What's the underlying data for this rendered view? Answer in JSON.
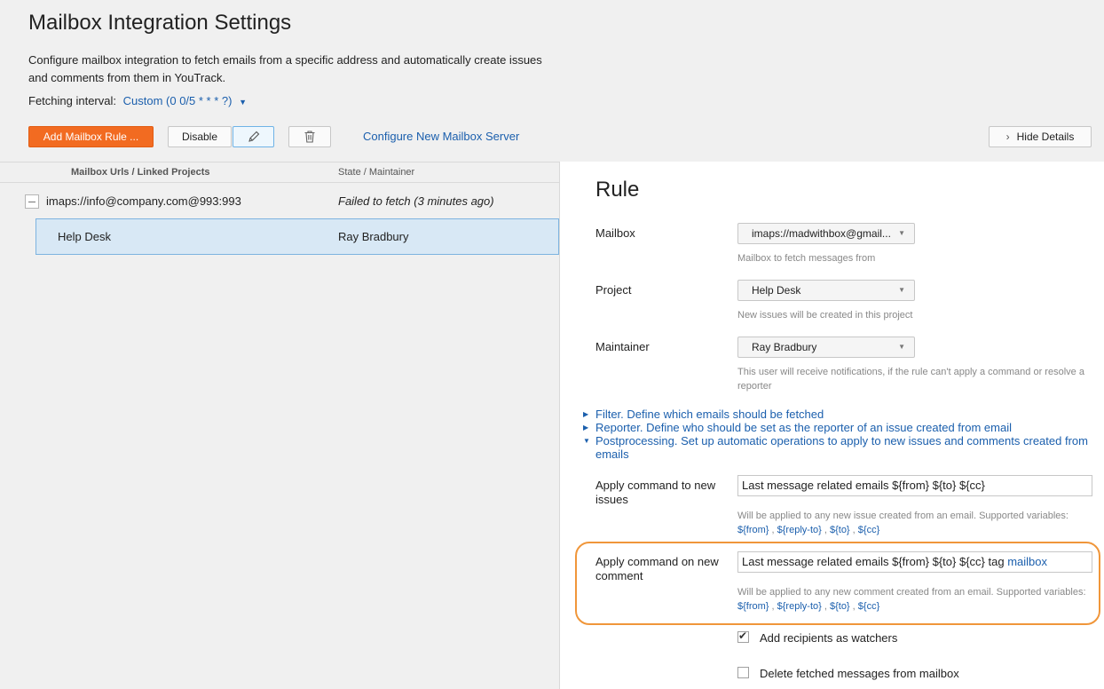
{
  "header": {
    "title": "Mailbox Integration Settings",
    "description": "Configure mailbox integration to fetch emails from a specific address and automatically create issues and comments from them in YouTrack.",
    "fetch_label": "Fetching interval:",
    "fetch_value": "Custom (0 0/5 * * * ?)"
  },
  "toolbar": {
    "add_label": "Add Mailbox Rule ...",
    "disable_label": "Disable",
    "configure_label": "Configure New Mailbox Server",
    "hide_details_label": "Hide Details"
  },
  "table": {
    "col_mailbox": "Mailbox Urls / Linked Projects",
    "col_state": "State / Maintainer",
    "mailbox_url": "imaps://info@company.com@993:993",
    "mailbox_state": "Failed to fetch (3 minutes ago)",
    "project": "Help Desk",
    "maintainer": "Ray Bradbury"
  },
  "rule": {
    "title": "Rule",
    "mailbox_label": "Mailbox",
    "mailbox_value": "imaps://madwithbox@gmail...",
    "mailbox_hint": "Mailbox to fetch messages from",
    "project_label": "Project",
    "project_value": "Help Desk",
    "project_hint": "New issues will be created in this project",
    "maintainer_label": "Maintainer",
    "maintainer_value": "Ray Bradbury",
    "maintainer_hint": "This user will receive notifications, if the rule can't apply a command or resolve a reporter",
    "sections": {
      "filter": "Filter. Define which emails should be fetched",
      "reporter": "Reporter. Define who should be set as the reporter of an issue created from email",
      "postprocessing": "Postprocessing. Set up automatic operations to apply to new issues and comments created from emails"
    },
    "cmd_issues_label": "Apply command to new issues",
    "cmd_issues_value": "Last message related emails ${from} ${to} ${cc}",
    "cmd_issues_hint": "Will be applied to any new issue created from an email. Supported variables:",
    "cmd_comment_label": "Apply command on new comment",
    "cmd_comment_value": "Last message related emails ${from} ${to} ${cc} tag",
    "cmd_comment_tag": "mailbox",
    "cmd_comment_hint": "Will be applied to any new comment created from an email. Supported variables:",
    "vars": [
      "${from}",
      "${reply-to}",
      "${to}",
      "${cc}"
    ],
    "watchers_label": "Add recipients as watchers",
    "watchers_checked": true,
    "delete_label": "Delete fetched messages from mailbox",
    "delete_checked": false
  }
}
